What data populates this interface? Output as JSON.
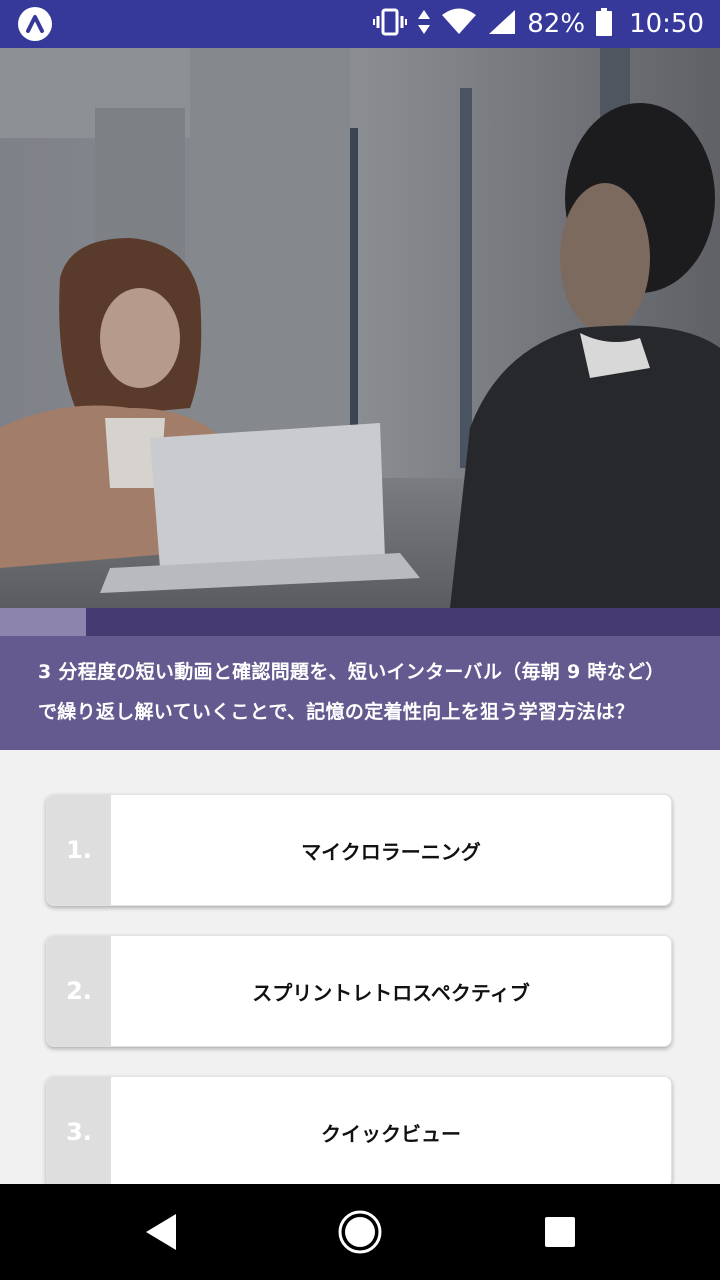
{
  "status_bar": {
    "battery_percent": "82%",
    "time": "10:50",
    "icons": [
      "app-logo-icon",
      "vibrate-icon",
      "data-transfer-icon",
      "wifi-icon",
      "signal-icon",
      "battery-icon"
    ]
  },
  "hero_image": {
    "description_icon": "office-meeting-photo"
  },
  "progress": {
    "fraction": 0.12
  },
  "question": {
    "line1": "3 分程度の短い動画と確認問題を、短いインターバル（毎朝 9 時など）",
    "line2": "で繰り返し解いていくことで、記憶の定着性向上を狙う学習方法は？"
  },
  "options": [
    {
      "number": "1.",
      "label": "マイクロラーニング"
    },
    {
      "number": "2.",
      "label": "スプリントレトロスペクティブ"
    },
    {
      "number": "3.",
      "label": "クイックビュー"
    }
  ],
  "nav_bar": {
    "icons": [
      "back-icon",
      "home-icon",
      "recents-icon"
    ]
  },
  "colors": {
    "status_bar": "#36399a",
    "question_bg": "#655a8f",
    "progress_track": "#453a72",
    "progress_fill": "#8d84ad"
  }
}
